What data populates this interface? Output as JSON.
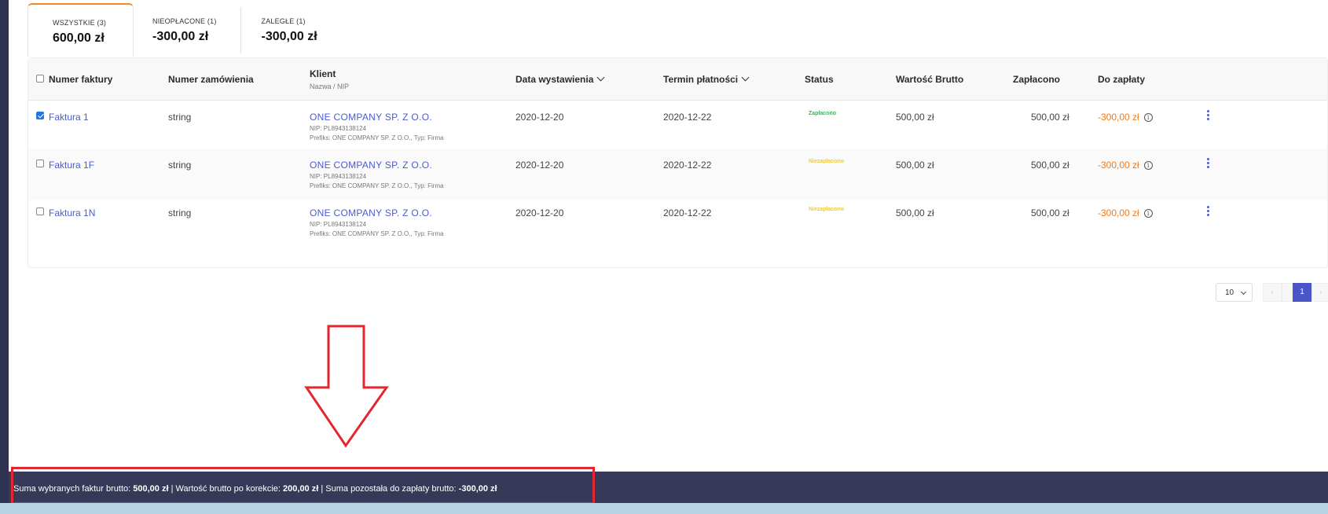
{
  "tabs": [
    {
      "label": "WSZYSTKIE (3)",
      "value": "600,00 zł",
      "active": true
    },
    {
      "label": "NIEOPŁACONE (1)",
      "value": "-300,00 zł",
      "active": false
    },
    {
      "label": "ZALEGŁE (1)",
      "value": "-300,00 zł",
      "active": false
    }
  ],
  "table": {
    "headers": {
      "invoice_number": "Numer faktury",
      "order_number": "Numer zamówienia",
      "client": "Klient",
      "client_sub": "Nazwa / NIP",
      "issue_date": "Data wystawienia",
      "due_date": "Termin płatności",
      "status": "Status",
      "gross_value": "Wartość Brutto",
      "paid": "Zapłacono",
      "to_pay": "Do zapłaty"
    },
    "rows": [
      {
        "checked": true,
        "invoice": "Faktura 1",
        "order": "string",
        "client_name": "ONE COMPANY SP. Z O.O.",
        "client_nip": "NIP: PL8943138124",
        "client_prefix": "Prefiks: ONE COMPANY SP. Z O.O., Typ: Firma",
        "issue_date": "2020-12-20",
        "due_date": "2020-12-22",
        "status": "Zapłacono",
        "status_kind": "paid",
        "gross": "500,00 zł",
        "paid": "500,00 zł",
        "to_pay": "-300,00 zł"
      },
      {
        "checked": false,
        "invoice": "Faktura 1F",
        "order": "string",
        "client_name": "ONE COMPANY SP. Z O.O.",
        "client_nip": "NIP: PL8943138124",
        "client_prefix": "Prefiks: ONE COMPANY SP. Z O.O., Typ: Firma",
        "issue_date": "2020-12-20",
        "due_date": "2020-12-22",
        "status": "Niezapłacono",
        "status_kind": "unpaid",
        "gross": "500,00 zł",
        "paid": "500,00 zł",
        "to_pay": "-300,00 zł"
      },
      {
        "checked": false,
        "invoice": "Faktura 1N",
        "order": "string",
        "client_name": "ONE COMPANY SP. Z O.O.",
        "client_nip": "NIP: PL8943138124",
        "client_prefix": "Prefiks: ONE COMPANY SP. Z O.O., Typ: Firma",
        "issue_date": "2020-12-20",
        "due_date": "2020-12-22",
        "status": "Niezapłacono",
        "status_kind": "unpaid",
        "gross": "500,00 zł",
        "paid": "500,00 zł",
        "to_pay": "-300,00 zł"
      }
    ]
  },
  "pagination": {
    "page_size": "10",
    "current_page": "1",
    "prev": "‹",
    "next": "›"
  },
  "footer": {
    "sum_label": "Suma wybranych faktur brutto:",
    "sum_value": "500,00 zł",
    "corr_label": "| Wartość brutto po korekcie:",
    "corr_value": "200,00 zł",
    "remain_label": "| Suma pozostała do zapłaty brutto:",
    "remain_value": "-300,00 zł"
  },
  "colors": {
    "accent_tab": "#f08a24",
    "link": "#4a5bd0",
    "paid": "#3cb35f",
    "unpaid": "#e9c94a",
    "due": "#f07a1a",
    "annotation": "#e3262f",
    "footer_bg": "#363a58"
  }
}
